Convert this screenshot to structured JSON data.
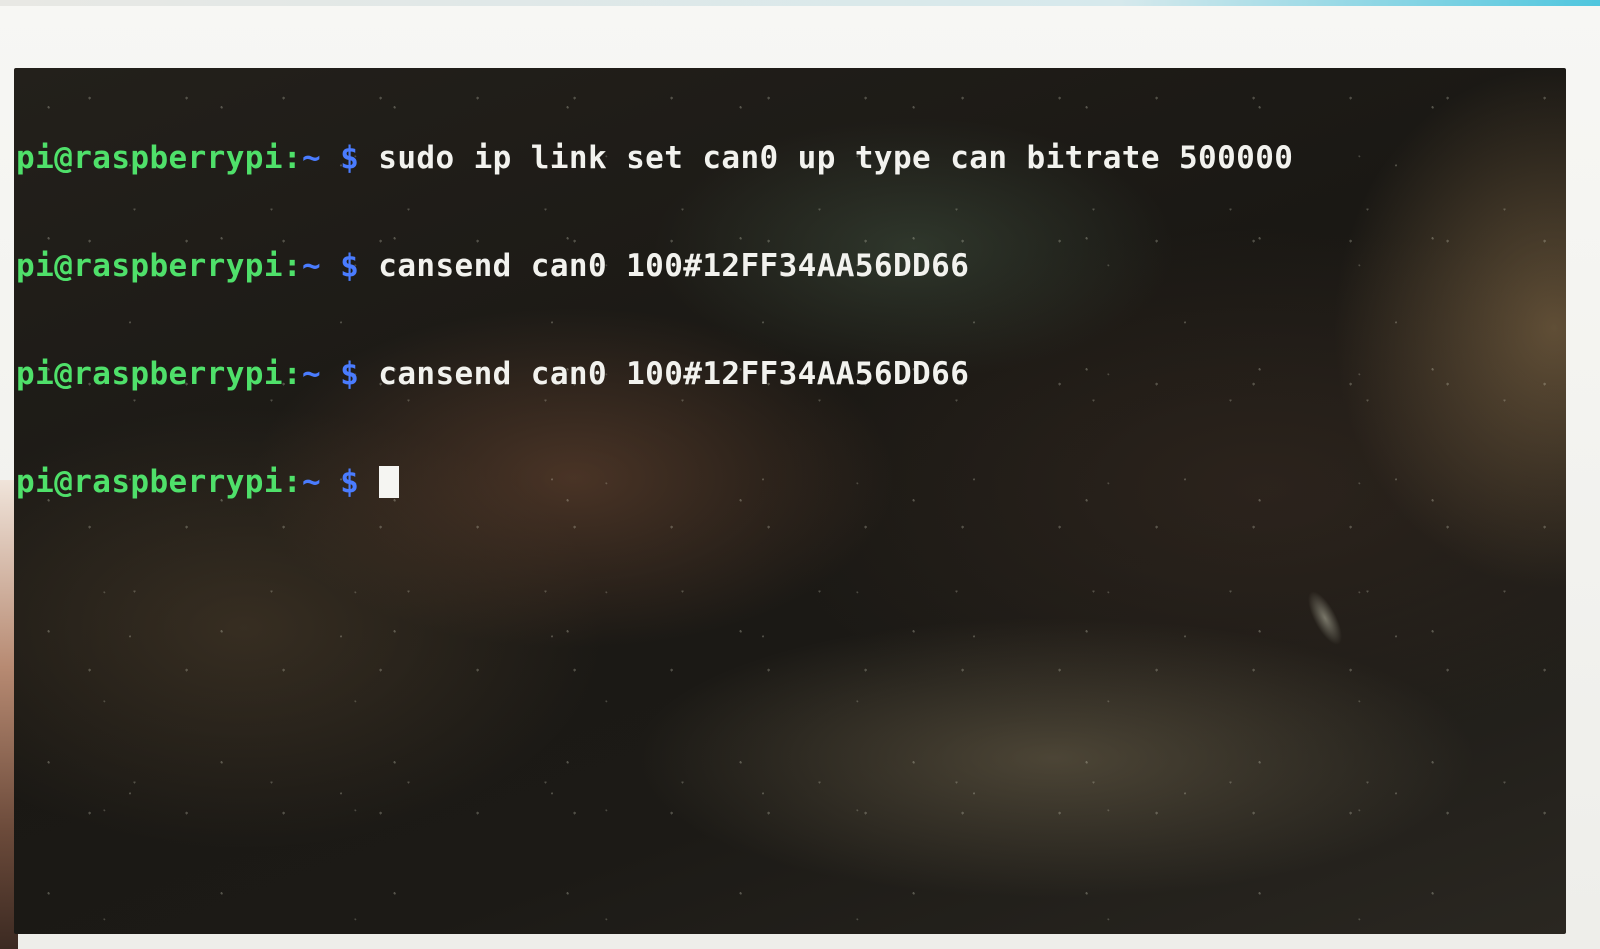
{
  "terminal": {
    "prompt": {
      "user_host": "pi@raspberrypi",
      "separator": ":",
      "cwd": "~",
      "symbol": "$"
    },
    "lines": [
      {
        "command": "sudo ip link set can0 up type can bitrate 500000"
      },
      {
        "command": "cansend can0 100#12FF34AA56DD66"
      },
      {
        "command": "cansend can0 100#12FF34AA56DD66"
      },
      {
        "command": ""
      }
    ],
    "colors": {
      "user_host": "#4fe06a",
      "cwd_and_symbol": "#4a7cff",
      "command_text": "#f2f2ee",
      "background": "#1c1a16"
    },
    "cursor_icon": "block-cursor-icon"
  }
}
